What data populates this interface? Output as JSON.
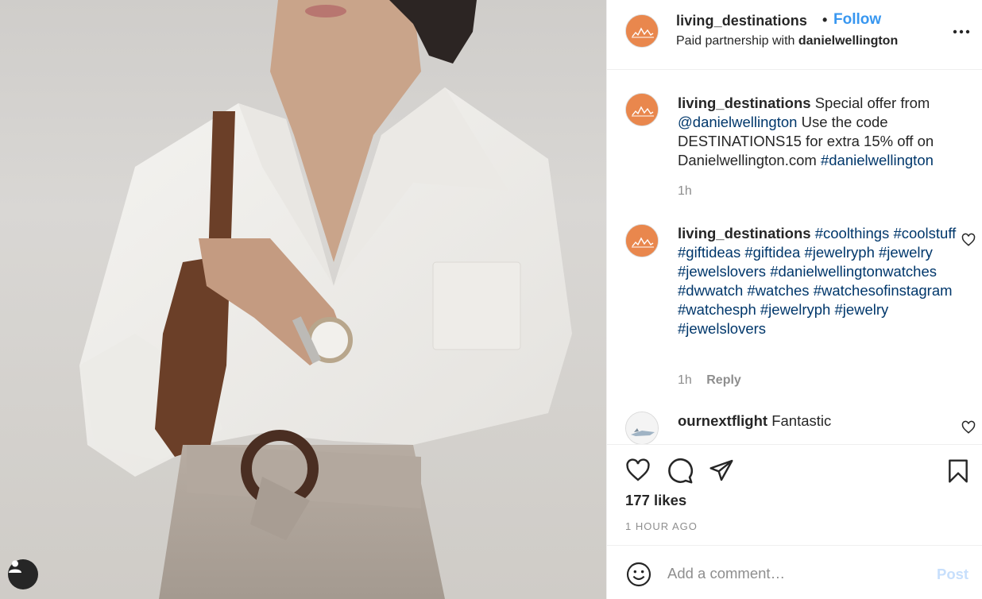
{
  "post": {
    "username": "living_destinations",
    "follow_label": "Follow",
    "dot": "•",
    "partnership_prefix": "Paid partnership with",
    "partner": "danielwellington"
  },
  "comments": [
    {
      "username": "living_destinations",
      "text_1": "Special offer from",
      "mention": "@danielwellington",
      "text_2": "Use the code DESTINATIONS15 for extra 15% off on Danielwellington.com",
      "hashtag": "#danielwellington",
      "time": "1h"
    },
    {
      "username": "living_destinations",
      "hashtags": [
        "#coolthings",
        "#coolstuff",
        "#giftideas",
        "#giftidea",
        "#jewelryph",
        "#jewelry",
        "#jewelslovers",
        "#danielwellingtonwatches",
        "#dwwatch",
        "#watches",
        "#watchesofinstagram",
        "#watchesph",
        "#jewelryph",
        "#jewelry",
        "#jewelslovers"
      ],
      "time": "1h",
      "reply_label": "Reply"
    },
    {
      "username": "ournextflight",
      "text": "Fantastic"
    }
  ],
  "engagement": {
    "likes": "177 likes",
    "time_ago": "1 HOUR AGO"
  },
  "composer": {
    "placeholder": "Add a comment…",
    "post_label": "Post"
  },
  "icons": [
    "user-tag-icon",
    "more-options-icon",
    "heart-icon",
    "comment-icon",
    "share-icon",
    "bookmark-icon",
    "emoji-icon"
  ],
  "colors": {
    "link_blue": "#3897f0",
    "hashtag_blue": "#00376b",
    "avatar_orange": "#e9874d",
    "muted_gray": "#8e8e8e",
    "post_disabled": "#c7dffc"
  }
}
